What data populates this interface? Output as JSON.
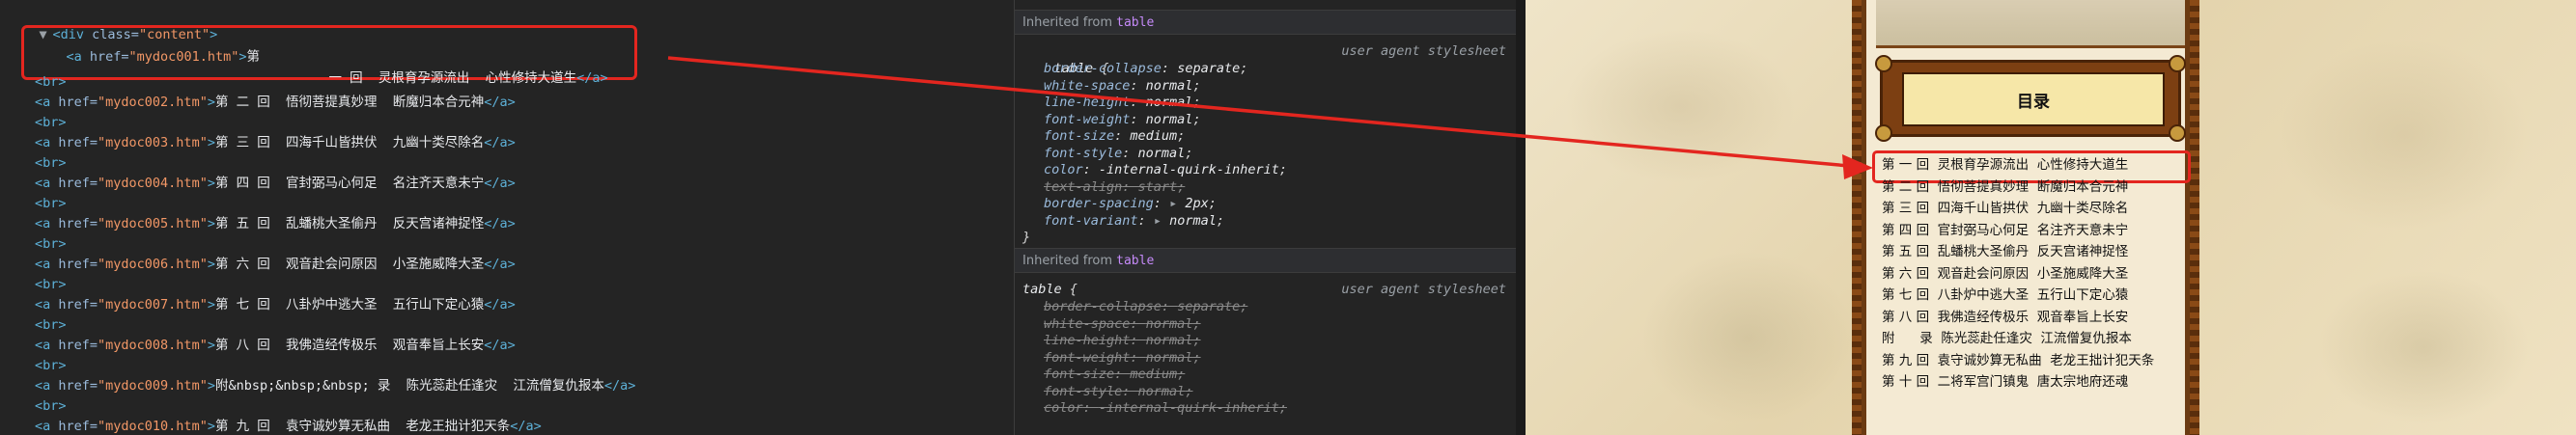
{
  "elements_panel": {
    "div_open": {
      "arrow": "▼",
      "tag_open": "<div ",
      "attr": "class=",
      "val": "\"content\"",
      "tag_close": ">"
    },
    "first_link_line1": {
      "tag_open": "<a ",
      "attr": "href=",
      "val": "\"mydoc001.htm\"",
      "tag_close": ">",
      "text": "第"
    },
    "first_link_line2": {
      "text": "一 回  灵根育孕源流出  心性修持大道生",
      "tag_close": "</a>"
    },
    "br": "<br>",
    "links": [
      {
        "href": "\"mydoc002.htm\"",
        "text": "第 二 回  悟彻菩提真妙理  断魔归本合元神"
      },
      {
        "href": "\"mydoc003.htm\"",
        "text": "第 三 回  四海千山皆拱伏  九幽十类尽除名"
      },
      {
        "href": "\"mydoc004.htm\"",
        "text": "第 四 回  官封弼马心何足  名注齐天意未宁"
      },
      {
        "href": "\"mydoc005.htm\"",
        "text": "第 五 回  乱蟠桃大圣偷丹  反天宫诸神捉怪"
      },
      {
        "href": "\"mydoc006.htm\"",
        "text": "第 六 回  观音赴会问原因  小圣施威降大圣"
      },
      {
        "href": "\"mydoc007.htm\"",
        "text": "第 七 回  八卦炉中逃大圣  五行山下定心猿"
      },
      {
        "href": "\"mydoc008.htm\"",
        "text": "第 八 回  我佛造经传极乐  观音奉旨上长安"
      },
      {
        "href": "\"mydoc009.htm\"",
        "text": "附&nbsp;&nbsp;&nbsp; 录  陈光蕊赴任逢灾  江流僧复仇报本"
      },
      {
        "href": "\"mydoc010.htm\"",
        "text": "第 九 回  袁守诚妙算无私曲  老龙王拙计犯天条"
      }
    ],
    "a_open": "<a ",
    "href_attr": "href=",
    "gt": ">",
    "a_close": "</a>"
  },
  "styles_panel": {
    "inherited_label": "Inherited from ",
    "inherited_from": "table",
    "selector": "table",
    "open_brace": " {",
    "close_brace": "}",
    "source": "user agent stylesheet",
    "rules_1": [
      {
        "prop": "border-collapse",
        "value": "separate",
        "struck": false
      },
      {
        "prop": "white-space",
        "value": "normal",
        "struck": false
      },
      {
        "prop": "line-height",
        "value": "normal",
        "struck": false
      },
      {
        "prop": "font-weight",
        "value": "normal",
        "struck": false
      },
      {
        "prop": "font-size",
        "value": "medium",
        "struck": false
      },
      {
        "prop": "font-style",
        "value": "normal",
        "struck": false
      },
      {
        "prop": "color",
        "value": "-internal-quirk-inherit",
        "struck": false
      },
      {
        "prop": "text-align",
        "value": "start",
        "struck": true
      },
      {
        "prop": "border-spacing",
        "value": "2px",
        "struck": false,
        "expand": true
      },
      {
        "prop": "font-variant",
        "value": "normal",
        "struck": false,
        "expand": true
      }
    ],
    "rules_2": [
      {
        "prop": "border-collapse",
        "value": "separate",
        "struck": true
      },
      {
        "prop": "white-space",
        "value": "normal",
        "struck": true
      },
      {
        "prop": "line-height",
        "value": "normal",
        "struck": true
      },
      {
        "prop": "font-weight",
        "value": "normal",
        "struck": true
      },
      {
        "prop": "font-size",
        "value": "medium",
        "struck": true
      },
      {
        "prop": "font-style",
        "value": "normal",
        "struck": true
      },
      {
        "prop": "color",
        "value": "-internal-quirk-inherit",
        "struck": true
      }
    ]
  },
  "rendered_page": {
    "title": "目录",
    "toc": [
      "第 一 回  灵根育孕源流出  心性修持大道生",
      "第 二 回  悟彻菩提真妙理  断魔归本合元神",
      "第 三 回  四海千山皆拱伏  九幽十类尽除名",
      "第 四 回  官封弼马心何足  名注齐天意未宁",
      "第 五 回  乱蟠桃大圣偷丹  反天宫诸神捉怪",
      "第 六 回  观音赴会问原因  小圣施威降大圣",
      "第 七 回  八卦炉中逃大圣  五行山下定心猿",
      "第 八 回  我佛造经传极乐  观音奉旨上长安",
      "附      录  陈光蕊赴任逢灾  江流僧复仇报本",
      "第 九 回  袁守诚妙算无私曲  老龙王拙计犯天条",
      "第 十 回  二将军宫门镇鬼  唐太宗地府还魂"
    ]
  },
  "colors": {
    "highlight_red": "#e3261f",
    "devtools_bg": "#242424",
    "tag_blue": "#5db0d7",
    "attr_value_orange": "#f29766",
    "book_frame_brown": "#6b3b12",
    "title_plate_yellow": "#f6e7a8"
  }
}
